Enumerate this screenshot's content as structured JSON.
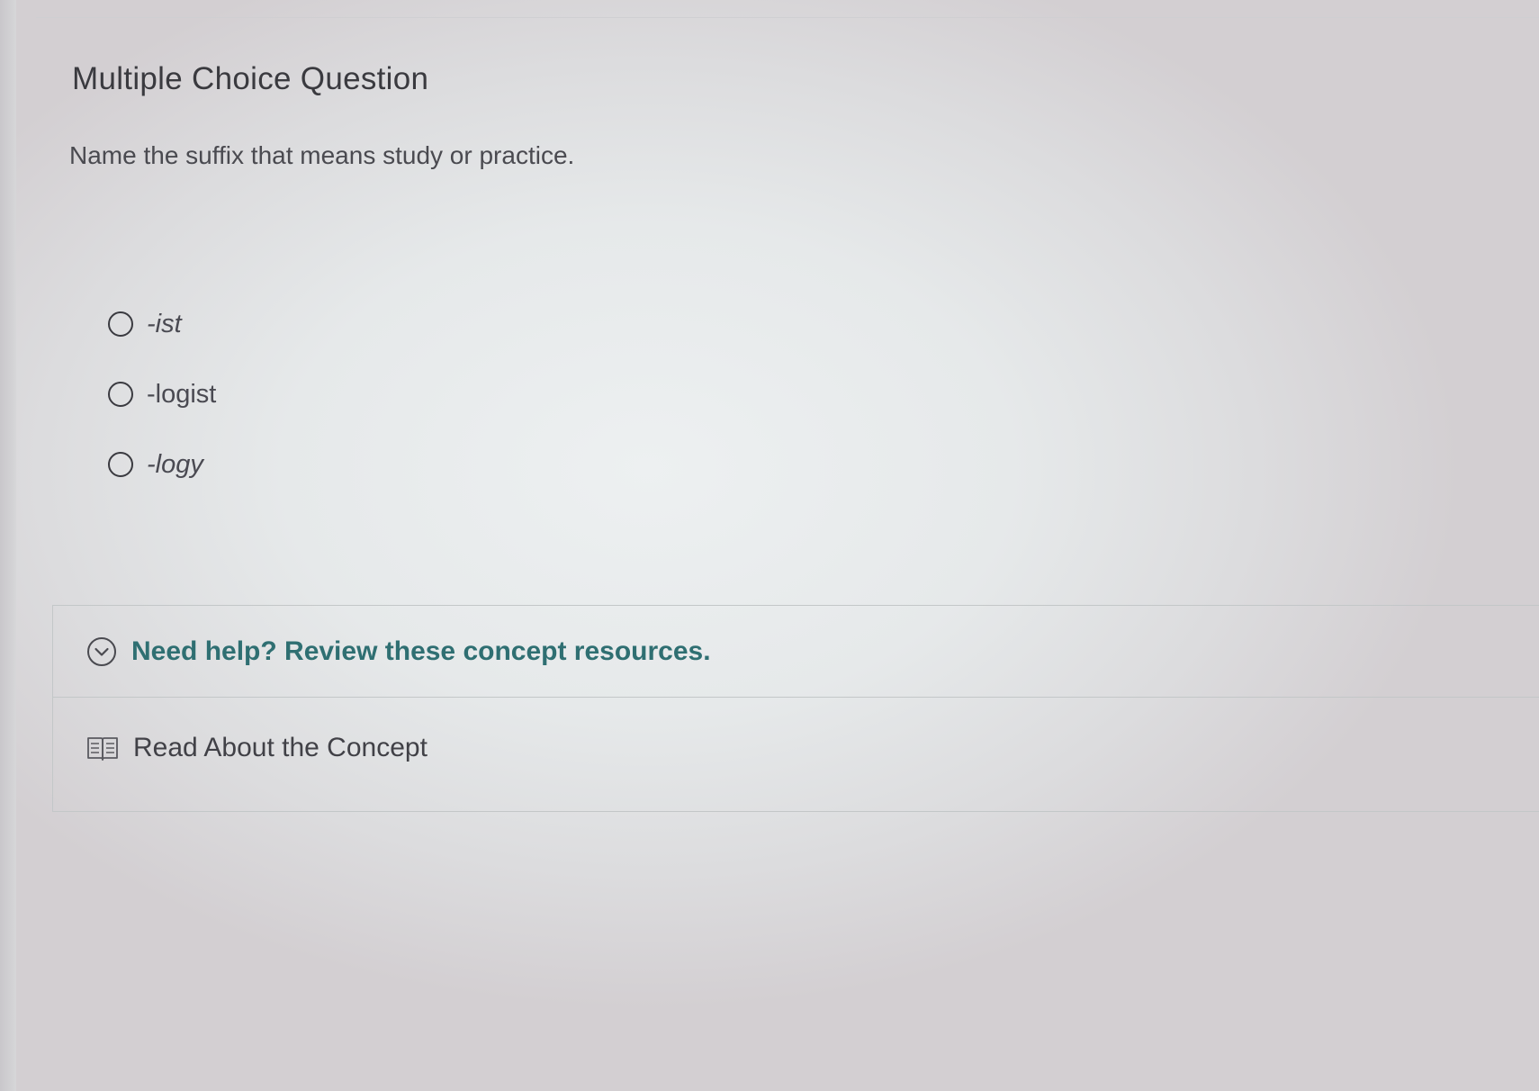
{
  "question": {
    "type_title": "Multiple Choice Question",
    "prompt": "Name the suffix that means study or practice."
  },
  "options": [
    {
      "label": "-ist",
      "italic": true,
      "selected": false
    },
    {
      "label": "-logist",
      "italic": false,
      "selected": false
    },
    {
      "label": "-logy",
      "italic": true,
      "selected": false
    }
  ],
  "help": {
    "header": "Need help? Review these concept resources.",
    "header_icon": "chevron-down-circle-icon",
    "resources": [
      {
        "label": "Read About the Concept",
        "icon": "book-icon"
      }
    ]
  },
  "colors": {
    "help_text": "#2f6f72",
    "body_text": "#4a4a50",
    "border": "#c3c7c8"
  }
}
